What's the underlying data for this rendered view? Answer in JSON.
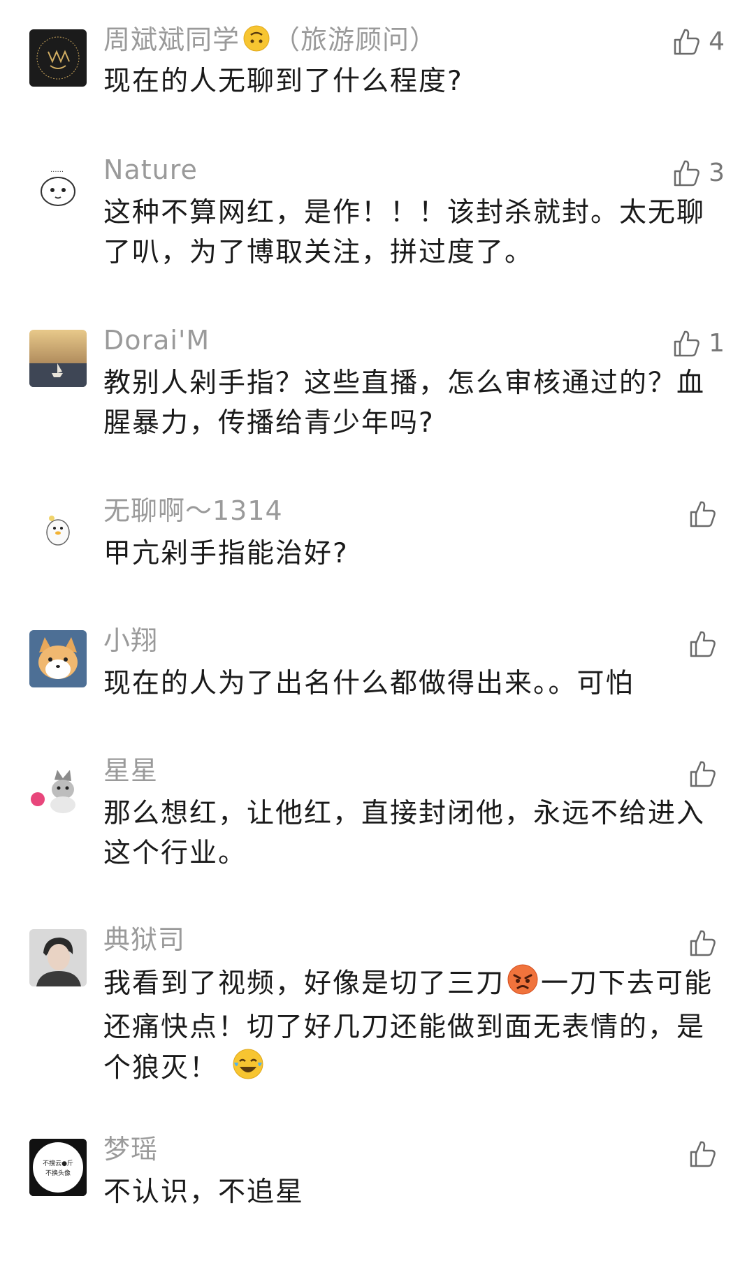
{
  "comments": [
    {
      "user": "周斌斌同学",
      "role": "（旅游顾问）",
      "text": "现在的人无聊到了什么程度?",
      "likes": "4",
      "avatar_icon": "gold-monogram-avatar"
    },
    {
      "user": "Nature",
      "text": "这种不算网红，是作！！！该封杀就封。太无聊了叭，为了博取关注，拼过度了。",
      "likes": "3",
      "avatar_icon": "cartoon-face-avatar"
    },
    {
      "user": "Dorai'M",
      "text": "教别人剁手指？这些直播，怎么审核通过的？血腥暴力，传播给青少年吗?",
      "likes": "1",
      "avatar_icon": "sunset-boat-avatar"
    },
    {
      "user": "无聊啊～1314",
      "text": "甲亢剁手指能治好?",
      "likes": "",
      "avatar_icon": "duck-avatar"
    },
    {
      "user": "小翔",
      "text": "现在的人为了出名什么都做得出来。。可怕",
      "likes": "",
      "avatar_icon": "corgi-avatar"
    },
    {
      "user": "星星",
      "text": "那么想红，让他红，直接封闭他，永远不给进入这个行业。",
      "likes": "",
      "avatar_icon": "kitten-avatar"
    },
    {
      "user": "典狱司",
      "text_a": "我看到了视频，好像是切了三刀",
      "text_b": "一刀下去可能还痛快点！切了好几刀还能做到面无表情的，是个狼灭！",
      "likes": "",
      "avatar_icon": "portrait-avatar"
    },
    {
      "user": "梦瑶",
      "text": "不认识，不追星",
      "likes": "",
      "avatar_icon": "text-circle-avatar",
      "avatar_line1": "不搜云●斤",
      "avatar_line2": "不换头像"
    }
  ],
  "colors": {
    "name": "#9a9a9a",
    "text": "#1a1a1a",
    "like": "#777777"
  }
}
